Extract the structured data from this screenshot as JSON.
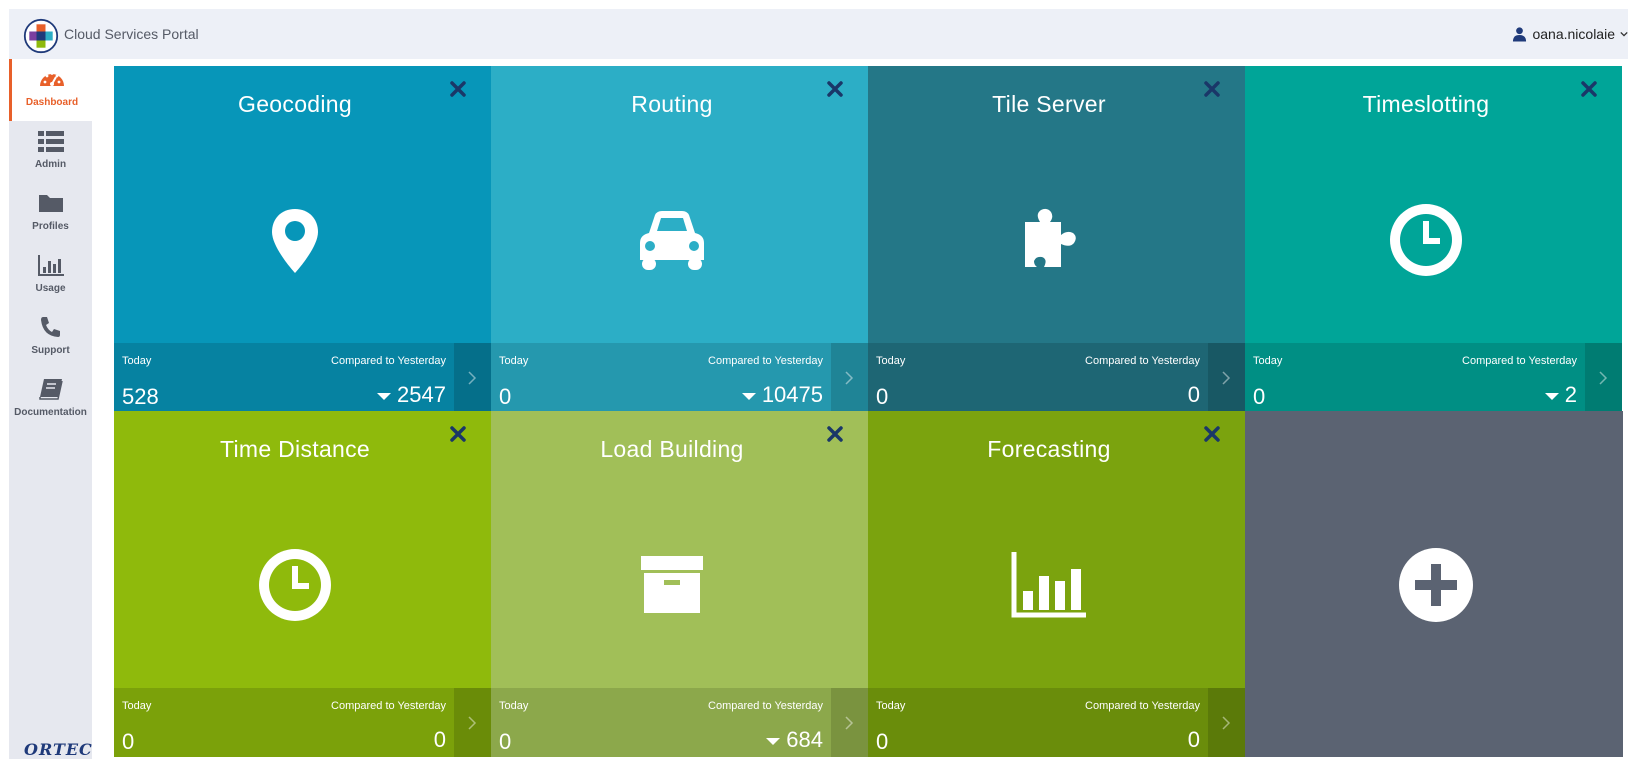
{
  "header": {
    "app_title": "Cloud Services Portal",
    "username": "oana.nicolaie"
  },
  "sidebar": {
    "items": [
      {
        "label": "Dashboard",
        "icon": "dashboard-gauge-icon",
        "active": true
      },
      {
        "label": "Admin",
        "icon": "list-icon",
        "active": false
      },
      {
        "label": "Profiles",
        "icon": "folder-icon",
        "active": false
      },
      {
        "label": "Usage",
        "icon": "bar-chart-icon",
        "active": false
      },
      {
        "label": "Support",
        "icon": "phone-icon",
        "active": false
      },
      {
        "label": "Documentation",
        "icon": "book-icon",
        "active": false
      }
    ],
    "brand": "ORTEC"
  },
  "colors": {
    "accent": "#e8602a",
    "close_icon": "#1a3768",
    "add_tile": "#5b6372"
  },
  "tiles": [
    {
      "title": "Geocoding",
      "icon": "map-marker-icon",
      "today_label": "Today",
      "compare_label": "Compared to Yesterday",
      "today_value": "528",
      "compare_value": "2547",
      "trend": "down",
      "color": "#0796b9",
      "footer_color": "#0682a1",
      "arrow_color": "#056f8a"
    },
    {
      "title": "Routing",
      "icon": "car-icon",
      "today_label": "Today",
      "compare_label": "Compared to Yesterday",
      "today_value": "0",
      "compare_value": "10475",
      "trend": "down",
      "color": "#2caec6",
      "footer_color": "#2598ae",
      "arrow_color": "#1f8496"
    },
    {
      "title": "Tile Server",
      "icon": "puzzle-piece-icon",
      "today_label": "Today",
      "compare_label": "Compared to Yesterday",
      "today_value": "0",
      "compare_value": "0",
      "trend": "none",
      "color": "#247787",
      "footer_color": "#1e6674",
      "arrow_color": "#185864"
    },
    {
      "title": "Timeslotting",
      "icon": "clock-icon",
      "today_label": "Today",
      "compare_label": "Compared to Yesterday",
      "today_value": "0",
      "compare_value": "2",
      "trend": "down",
      "color": "#00a598",
      "footer_color": "#008f84",
      "arrow_color": "#007c72"
    },
    {
      "title": "Time Distance",
      "icon": "clock-icon",
      "today_label": "Today",
      "compare_label": "Compared to Yesterday",
      "today_value": "0",
      "compare_value": "0",
      "trend": "none",
      "color": "#8fba0c",
      "footer_color": "#7ba10a",
      "arrow_color": "#6a8c08"
    },
    {
      "title": "Load Building",
      "icon": "archive-box-icon",
      "today_label": "Today",
      "compare_label": "Compared to Yesterday",
      "today_value": "0",
      "compare_value": "684",
      "trend": "down",
      "color": "#a1bf58",
      "footer_color": "#8ca84b",
      "arrow_color": "#7a933f"
    },
    {
      "title": "Forecasting",
      "icon": "bar-chart-icon",
      "today_label": "Today",
      "compare_label": "Compared to Yesterday",
      "today_value": "0",
      "compare_value": "0",
      "trend": "none",
      "color": "#7ba30e",
      "footer_color": "#6a8d0b",
      "arrow_color": "#5b7a09"
    }
  ]
}
